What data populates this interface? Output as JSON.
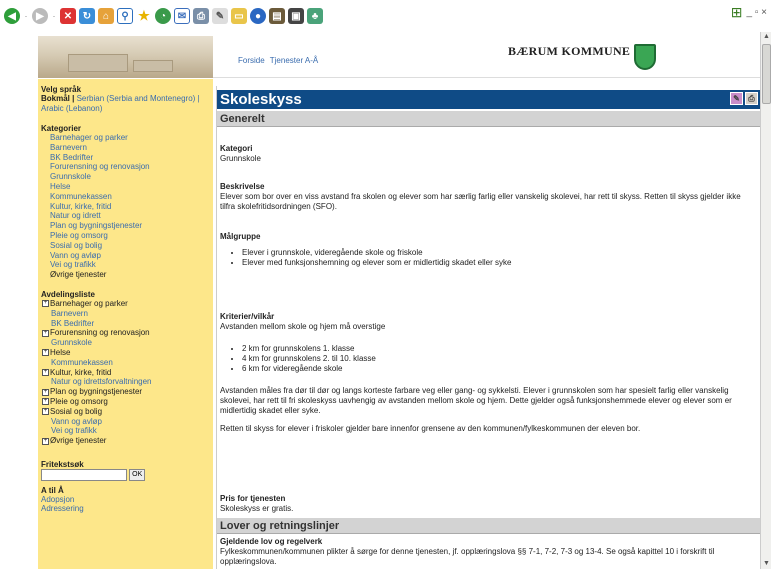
{
  "toolbar": {
    "icons": [
      "back-icon",
      "forward-icon",
      "stop-icon",
      "refresh-icon",
      "home-icon",
      "search-icon",
      "favorites-icon",
      "history-icon",
      "mail-icon",
      "print-icon",
      "edit-icon",
      "discuss-icon",
      "messenger-icon",
      "research-icon",
      "media-icon",
      "messenger2-icon"
    ]
  },
  "window": {
    "controls": "_ ▫ ×"
  },
  "banner": {
    "nav_forside": "Forside",
    "nav_tjenester": "Tjenester A-Å",
    "brand": "BÆRUM KOMMUNE"
  },
  "language": {
    "heading": "Velg språk",
    "selected": "Bokmål |",
    "serbian": "Serbian (Serbia and Montenegro) |",
    "arabic": "Arabic (Lebanon)"
  },
  "categories": {
    "heading": "Kategorier",
    "items": [
      "Barnehager og parker",
      "Barnevern",
      "BK Bedrifter",
      "Forurensning og renovasjon",
      "Grunnskole",
      "Helse",
      "Kommunekassen",
      "Kultur, kirke, fritid",
      "Natur og idrett",
      "Plan og bygningstjenester",
      "Pleie og omsorg",
      "Sosial og bolig",
      "Vann og avløp",
      "Vei og trafikk",
      "Øvrige tjenester"
    ]
  },
  "departments": {
    "heading": "Avdelingsliste",
    "items": [
      {
        "label": "Barnehager og parker",
        "plus": true,
        "sub": false
      },
      {
        "label": "Barnevern",
        "plus": false,
        "sub": true
      },
      {
        "label": "BK Bedrifter",
        "plus": false,
        "sub": true
      },
      {
        "label": "Forurensning og renovasjon",
        "plus": true,
        "sub": false
      },
      {
        "label": "Grunnskole",
        "plus": false,
        "sub": true
      },
      {
        "label": "Helse",
        "plus": true,
        "sub": false
      },
      {
        "label": "Kommunekassen",
        "plus": false,
        "sub": true
      },
      {
        "label": "Kultur, kirke, fritid",
        "plus": true,
        "sub": false
      },
      {
        "label": "Natur og idrettsforvaltningen",
        "plus": false,
        "sub": true
      },
      {
        "label": "Plan og bygningstjenester",
        "plus": true,
        "sub": false
      },
      {
        "label": "Pleie og omsorg",
        "plus": true,
        "sub": false
      },
      {
        "label": "Sosial og bolig",
        "plus": true,
        "sub": false
      },
      {
        "label": "Vann og avløp",
        "plus": false,
        "sub": true
      },
      {
        "label": "Vei og trafikk",
        "plus": false,
        "sub": true
      },
      {
        "label": "Øvrige tjenester",
        "plus": true,
        "sub": false
      }
    ]
  },
  "freetext": {
    "heading": "Fritekstsøk",
    "value": "",
    "ok_label": "OK"
  },
  "atoa": {
    "heading": "A til Å",
    "links": [
      "Adopsjon",
      "Adressering"
    ]
  },
  "main": {
    "title": "Skoleskyss",
    "section1": "Generelt",
    "kategori_label": "Kategori",
    "kategori_value": "Grunnskole",
    "beskrivelse_label": "Beskrivelse",
    "beskrivelse_text": "Elever som bor over en viss avstand fra skolen og elever som har særlig farlig eller vanskelig skolevei, har rett til skyss. Retten til skyss gjelder ikke tilfra skolefritidsordningen (SFO).",
    "malgruppe_label": "Målgruppe",
    "malgruppe_items": [
      "Elever i grunnskole, videregående skole og friskole",
      "Elever med funksjonshemning og elever som er midlertidig skadet eller syke"
    ],
    "kriterier_label": "Kriterier/vilkår",
    "kriterier_intro": "Avstanden mellom skole og hjem må overstige",
    "kriterier_items": [
      "2 km for grunnskolens 1. klasse",
      "4 km for grunnskolens 2. til 10. klasse",
      "6 km for videregående skole"
    ],
    "kriterier_p1": "Avstanden måles fra dør til dør og langs korteste farbare veg eller gang- og sykkelsti. Elever i grunnskolen som har spesielt farlig eller vanskelig skolevei, har rett til fri skoleskyss uavhengig av avstanden mellom skole og hjem. Dette gjelder også funksjonshemmede elever og elever som er midlertidig skadet eller syke.",
    "kriterier_p2": "Retten til skyss for elever i friskoler gjelder bare innenfor grensene av den kommunen/fylkeskommunen der eleven bor.",
    "pris_label": "Pris for tjenesten",
    "pris_text": "Skoleskyss er gratis.",
    "section2": "Lover og retningslinjer",
    "lov_label": "Gjeldende lov og regelverk",
    "lov_text": "Fylkeskommunen/kommunen plikter å sørge for denne tjenesten, jf. opplæringslova §§ 7-1, 7-2, 7-3 og 13-4. Se også kapittel 10 i forskrift til opplæringslova."
  }
}
